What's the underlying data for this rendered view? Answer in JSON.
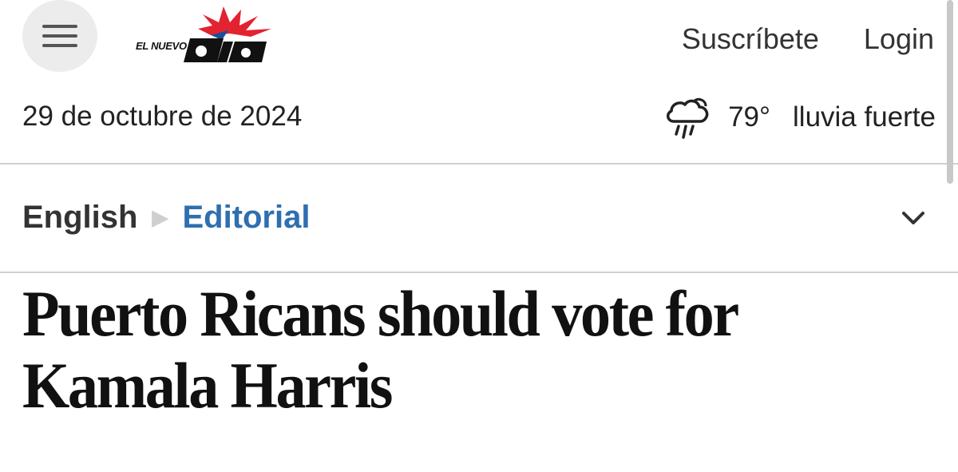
{
  "header": {
    "menu_icon": "hamburger-menu-icon",
    "logo": {
      "small_text": "EL NUEVO",
      "big_text": "día",
      "colors": [
        "#e3232f",
        "#1b4f9c",
        "#111111"
      ]
    },
    "subscribe_label": "Suscríbete",
    "login_label": "Login"
  },
  "info_bar": {
    "date": "29 de octubre de 2024",
    "weather": {
      "icon": "heavy-rain-cloud-icon",
      "temperature": "79°",
      "description": "lluvia fuerte"
    }
  },
  "breadcrumb": {
    "items": [
      "English",
      "Editorial"
    ],
    "separator_icon": "triangle-right-icon",
    "expand_icon": "chevron-down-icon",
    "active_color": "#2e6fb0"
  },
  "article": {
    "headline": "Puerto Ricans should vote for Kamala Harris"
  }
}
